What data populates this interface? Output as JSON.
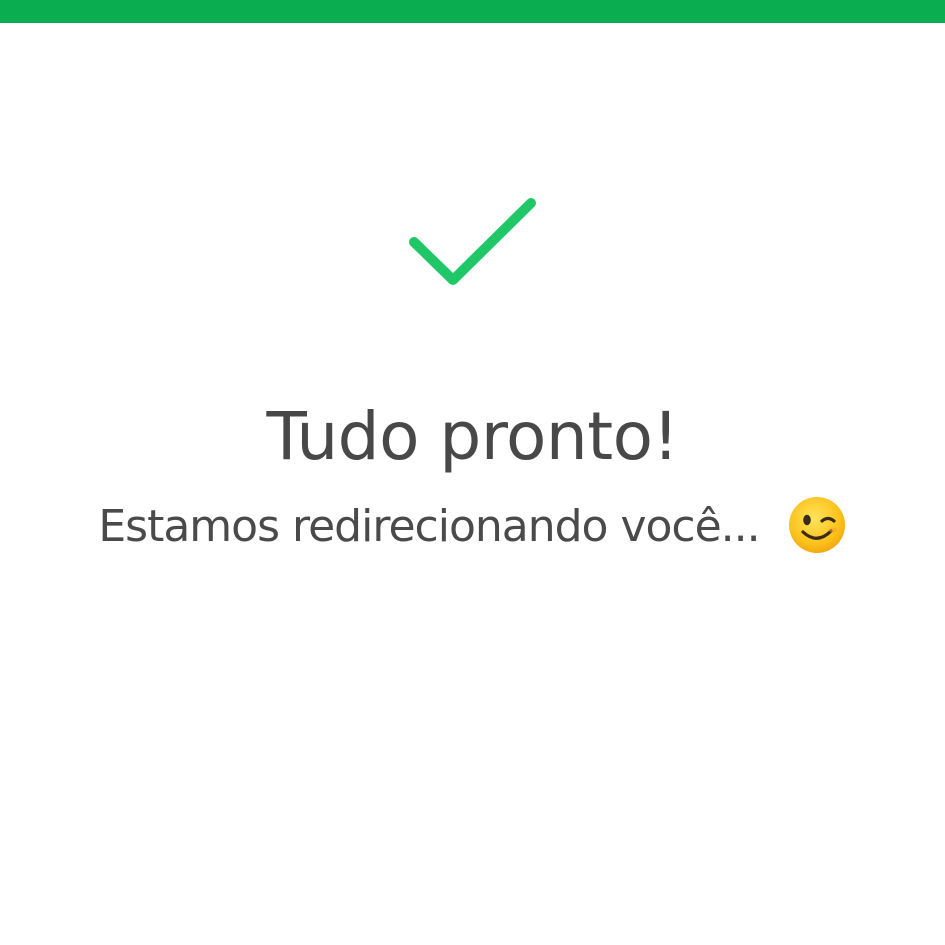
{
  "colors": {
    "top_bar": "#0aad50",
    "checkmark": "#1fc767",
    "text": "#484848",
    "background": "#ffffff"
  },
  "status": {
    "icon": "checkmark-icon",
    "title": "Tudo pronto!",
    "message": "Estamos redirecionando você...",
    "emoji": "winking-face-emoji"
  }
}
